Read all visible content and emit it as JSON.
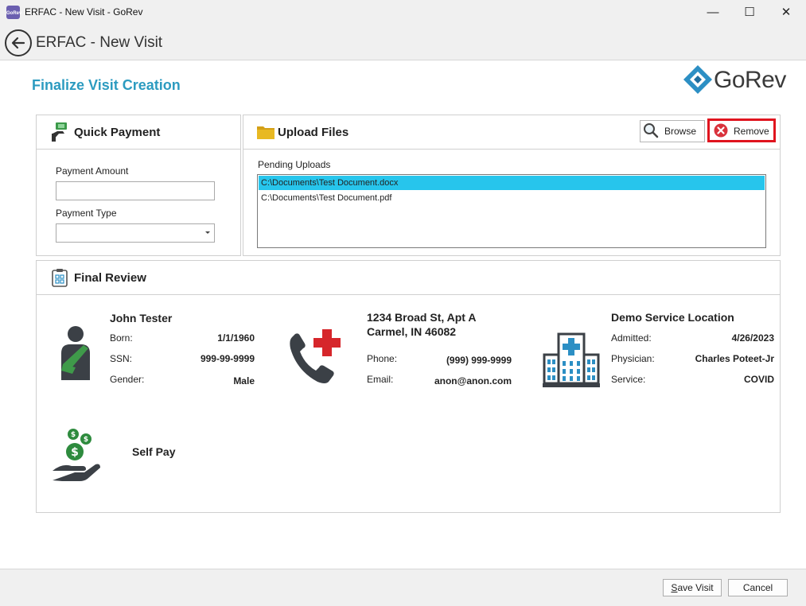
{
  "window": {
    "icon_text": "GoRev",
    "title": "ERFAC - New Visit - GoRev",
    "minimize_glyph": "—",
    "maximize_glyph": "☐",
    "close_glyph": "✕"
  },
  "header": {
    "title": "ERFAC - New Visit"
  },
  "page": {
    "title": "Finalize Visit Creation"
  },
  "logo": {
    "text": "GoRev"
  },
  "quick_payment": {
    "title": "Quick Payment",
    "amount_label": "Payment Amount",
    "amount_value": "",
    "type_label": "Payment Type",
    "type_value": ""
  },
  "upload_files": {
    "title": "Upload Files",
    "browse_label": "Browse",
    "remove_label": "Remove",
    "pending_label": "Pending Uploads",
    "files": [
      "C:\\Documents\\Test Document.docx",
      "C:\\Documents\\Test Document.pdf"
    ],
    "selected_index": 0
  },
  "final_review": {
    "title": "Final Review",
    "patient": {
      "name": "John Tester",
      "born_label": "Born:",
      "born": "1/1/1960",
      "ssn_label": "SSN:",
      "ssn": "999-99-9999",
      "gender_label": "Gender:",
      "gender": "Male"
    },
    "contact": {
      "address_line1": "1234 Broad St, Apt A",
      "address_line2": "Carmel, IN 46082",
      "phone_label": "Phone:",
      "phone": "(999) 999-9999",
      "email_label": "Email:",
      "email": "anon@anon.com"
    },
    "location": {
      "name": "Demo Service Location",
      "admitted_label": "Admitted:",
      "admitted": "4/26/2023",
      "physician_label": "Physician:",
      "physician": "Charles Poteet-Jr",
      "service_label": "Service:",
      "service": "COVID"
    },
    "payment": {
      "text": "Self Pay"
    }
  },
  "footer": {
    "save_first": "S",
    "save_rest": "ave Visit",
    "cancel_label": "Cancel"
  },
  "colors": {
    "accent": "#2c9bc0",
    "selection": "#27c5ec",
    "remove_highlight": "#e0141e",
    "remove_icon": "#d9323c",
    "red_cross": "#d6262b",
    "money_green": "#2e8b3e",
    "hospital_blue": "#2c8fc4"
  }
}
